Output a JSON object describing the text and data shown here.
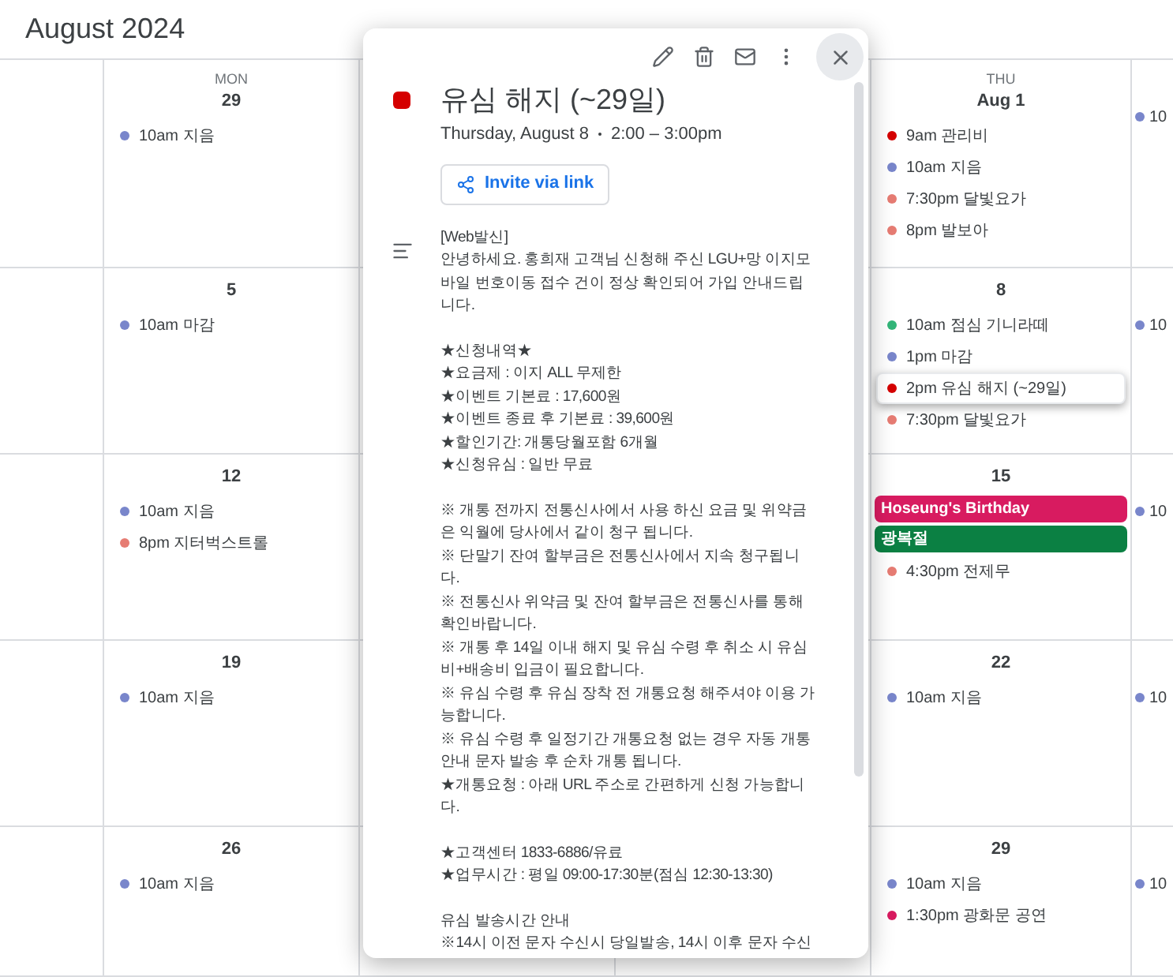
{
  "header": {
    "title": "August 2024"
  },
  "weeks": [
    {
      "mon": {
        "weekday": "MON",
        "date": "29",
        "events": [
          {
            "label": "10am 지음",
            "kind": "timed",
            "color": "#7986cb",
            "selected": false
          }
        ]
      },
      "thu": {
        "weekday": "THU",
        "date": "Aug 1",
        "events": [
          {
            "label": "9am 관리비",
            "kind": "timed",
            "color": "#d50000",
            "selected": false
          },
          {
            "label": "10am 지음",
            "kind": "timed",
            "color": "#7986cb",
            "selected": false
          },
          {
            "label": "7:30pm 달빛요가",
            "kind": "timed",
            "color": "#e67c73",
            "selected": false
          },
          {
            "label": "8pm 발보아",
            "kind": "timed",
            "color": "#e67c73",
            "selected": false
          }
        ]
      },
      "fri": {
        "events": [
          {
            "label": "10",
            "kind": "timed",
            "color": "#7986cb",
            "selected": false
          }
        ]
      }
    },
    {
      "mon": {
        "date": "5",
        "events": [
          {
            "label": "10am 마감",
            "kind": "timed",
            "color": "#7986cb",
            "selected": false
          }
        ]
      },
      "thu": {
        "date": "8",
        "events": [
          {
            "label": "10am 점심 기니라떼",
            "kind": "timed",
            "color": "#33b679",
            "selected": false
          },
          {
            "label": "1pm 마감",
            "kind": "timed",
            "color": "#7986cb",
            "selected": false
          },
          {
            "label": "2pm 유심 해지 (~29일)",
            "kind": "timed",
            "color": "#d50000",
            "selected": true
          },
          {
            "label": "7:30pm 달빛요가",
            "kind": "timed",
            "color": "#e67c73",
            "selected": false
          }
        ]
      },
      "fri": {
        "events": [
          {
            "label": "10",
            "kind": "timed",
            "color": "#7986cb",
            "selected": false
          }
        ]
      }
    },
    {
      "mon": {
        "date": "12",
        "events": [
          {
            "label": "10am 지음",
            "kind": "timed",
            "color": "#7986cb",
            "selected": false
          },
          {
            "label": "8pm 지터벅스트롤",
            "kind": "timed",
            "color": "#e67c73",
            "selected": false
          }
        ]
      },
      "thu": {
        "date": "15",
        "events": [
          {
            "label": "Hoseung's Birthday",
            "kind": "allday",
            "color": "#d81b60",
            "selected": false
          },
          {
            "label": "광복절",
            "kind": "allday",
            "color": "#0b8043",
            "selected": false
          },
          {
            "label": "4:30pm 전제무",
            "kind": "timed",
            "color": "#e67c73",
            "selected": false
          }
        ]
      },
      "fri": {
        "events": [
          {
            "label": "10",
            "kind": "timed",
            "color": "#7986cb",
            "selected": false
          }
        ]
      }
    },
    {
      "mon": {
        "date": "19",
        "events": [
          {
            "label": "10am 지음",
            "kind": "timed",
            "color": "#7986cb",
            "selected": false
          }
        ]
      },
      "thu": {
        "date": "22",
        "events": [
          {
            "label": "10am 지음",
            "kind": "timed",
            "color": "#7986cb",
            "selected": false
          }
        ]
      },
      "fri": {
        "events": [
          {
            "label": "10",
            "kind": "timed",
            "color": "#7986cb",
            "selected": false
          }
        ]
      }
    },
    {
      "mon": {
        "date": "26",
        "events": [
          {
            "label": "10am 지음",
            "kind": "timed",
            "color": "#7986cb",
            "selected": false
          }
        ]
      },
      "thu": {
        "date": "29",
        "events": [
          {
            "label": "10am 지음",
            "kind": "timed",
            "color": "#7986cb",
            "selected": false
          },
          {
            "label": "1:30pm 광화문 공연",
            "kind": "timed",
            "color": "#d81b60",
            "selected": false
          }
        ]
      },
      "fri": {
        "events": [
          {
            "label": "10",
            "kind": "timed",
            "color": "#7986cb",
            "selected": false
          }
        ]
      }
    }
  ],
  "popup": {
    "title": "유심 해지 (~29일)",
    "color": "#d50000",
    "date": "Thursday, August 8",
    "time": "2:00 – 3:00pm",
    "invite_button": "Invite via link",
    "description": [
      [
        "[Web발신]",
        "안녕하세요. 홍희재 고객님 신청해 주신 LGU+망 이지모",
        "바일 번호이동 접수 건이 정상 확인되어 가입 안내드립",
        "니다."
      ],
      [
        "★신청내역★",
        "★요금제 : 이지 ALL 무제한",
        "★이벤트 기본료 : 17,600원",
        "★이벤트 종료 후 기본료 : 39,600원",
        "★할인기간: 개통당월포함 6개월",
        "★신청유심 : 일반 무료"
      ],
      [
        "※ 개통 전까지 전통신사에서 사용 하신 요금 및 위약금",
        "은 익월에 당사에서 같이 청구 됩니다.",
        "※ 단말기 잔여 할부금은 전통신사에서 지속 청구됩니",
        "다.",
        "※ 전통신사 위약금 및 잔여 할부금은 전통신사를 통해",
        "확인바랍니다.",
        "※ 개통 후 14일 이내 해지 및 유심 수령 후 취소 시 유심",
        "비+배송비 입금이 필요합니다.",
        "※ 유심 수령 후 유심 장착 전 개통요청 해주셔야 이용 가",
        "능합니다.",
        "※ 유심 수령 후 일정기간 개통요청 없는 경우 자동 개통",
        "안내 문자 발송 후 순차 개통 됩니다.",
        "★개통요청 : 아래 URL 주소로 간편하게 신청 가능합니",
        "다."
      ],
      [
        "★고객센터 1833-6886/유료",
        "★업무시간 : 평일 09:00-17:30분(점심 12:30-13:30)"
      ],
      [
        "유심 발송시간 안내",
        "※14시 이전 문자 수신시 당일발송, 14시 이후 문자 수신"
      ]
    ]
  }
}
